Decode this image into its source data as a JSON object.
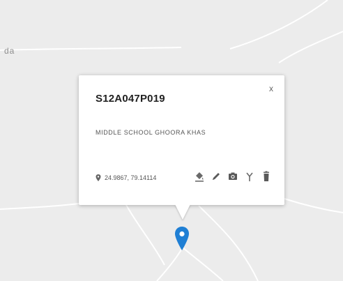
{
  "map": {
    "place_label": "da",
    "background_color": "#ececec",
    "road_color": "#ffffff"
  },
  "popup": {
    "title": "S12A047P019",
    "subtitle": "MIDDLE SCHOOL GHOORA KHAS",
    "close_label": "x",
    "coordinates": "24.9867, 79.14114",
    "actions": [
      {
        "name": "fill-color-icon"
      },
      {
        "name": "edit-pencil-icon"
      },
      {
        "name": "camera-icon"
      },
      {
        "name": "antenna-icon"
      },
      {
        "name": "delete-trash-icon"
      }
    ]
  },
  "marker": {
    "color": "#1f7fd4"
  }
}
